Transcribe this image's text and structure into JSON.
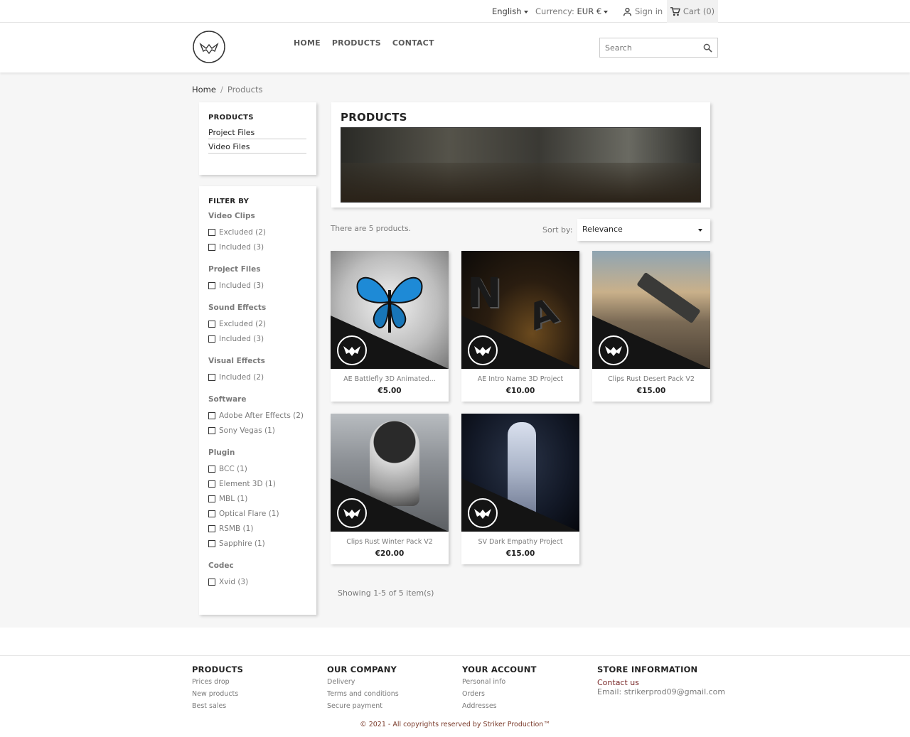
{
  "topbar": {
    "language": "English",
    "currency_label": "Currency:",
    "currency_value": "EUR €",
    "signin": "Sign in",
    "cart": "Cart (0)"
  },
  "nav": {
    "home": "HOME",
    "products": "PRODUCTS",
    "contact": "CONTACT"
  },
  "search": {
    "placeholder": "Search"
  },
  "breadcrumb": {
    "home": "Home",
    "current": "Products"
  },
  "categories": {
    "title": "PRODUCTS",
    "items": [
      "Project Files",
      "Video Files"
    ]
  },
  "filters": {
    "title": "FILTER BY",
    "groups": [
      {
        "title": "Video Clips",
        "options": [
          "Excluded (2)",
          "Included (3)"
        ]
      },
      {
        "title": "Project Files",
        "options": [
          "Included (3)"
        ]
      },
      {
        "title": "Sound Effects",
        "options": [
          "Excluded (2)",
          "Included (3)"
        ]
      },
      {
        "title": "Visual Effects",
        "options": [
          "Included (2)"
        ]
      },
      {
        "title": "Software",
        "options": [
          "Adobe After Effects (2)",
          "Sony Vegas (1)"
        ]
      },
      {
        "title": "Plugin",
        "options": [
          "BCC (1)",
          "Element 3D (1)",
          "MBL (1)",
          "Optical Flare (1)",
          "RSMB (1)",
          "Sapphire (1)"
        ]
      },
      {
        "title": "Codec",
        "options": [
          "Xvid (3)"
        ]
      }
    ]
  },
  "listing": {
    "title": "PRODUCTS",
    "count": "There are 5 products.",
    "sort_label": "Sort by:",
    "sort_value": "Relevance",
    "showing": "Showing 1-5 of 5 item(s)"
  },
  "products": [
    {
      "name": "AE Battlefly 3D Animated...",
      "price": "€5.00",
      "image": "butterfly"
    },
    {
      "name": "AE Intro Name 3D Project",
      "price": "€10.00",
      "image": "intro-letters"
    },
    {
      "name": "Clips Rust Desert Pack V2",
      "price": "€15.00",
      "image": "desert-gun"
    },
    {
      "name": "Clips Rust Winter Pack V2",
      "price": "€20.00",
      "image": "winter-soldier"
    },
    {
      "name": "SV Dark Empathy Project",
      "price": "€15.00",
      "image": "dark-soldier"
    }
  ],
  "footer": {
    "products": {
      "title": "PRODUCTS",
      "links": [
        "Prices drop",
        "New products",
        "Best sales"
      ]
    },
    "company": {
      "title": "OUR COMPANY",
      "links": [
        "Delivery",
        "Terms and conditions",
        "Secure payment"
      ]
    },
    "account": {
      "title": "YOUR ACCOUNT",
      "links": [
        "Personal info",
        "Orders",
        "Addresses"
      ]
    },
    "store": {
      "title": "STORE INFORMATION",
      "contact": "Contact us",
      "email": "Email: strikerprod09@gmail.com"
    },
    "copyright": "© 2021 - All copyrights reserved by Striker Production™"
  }
}
